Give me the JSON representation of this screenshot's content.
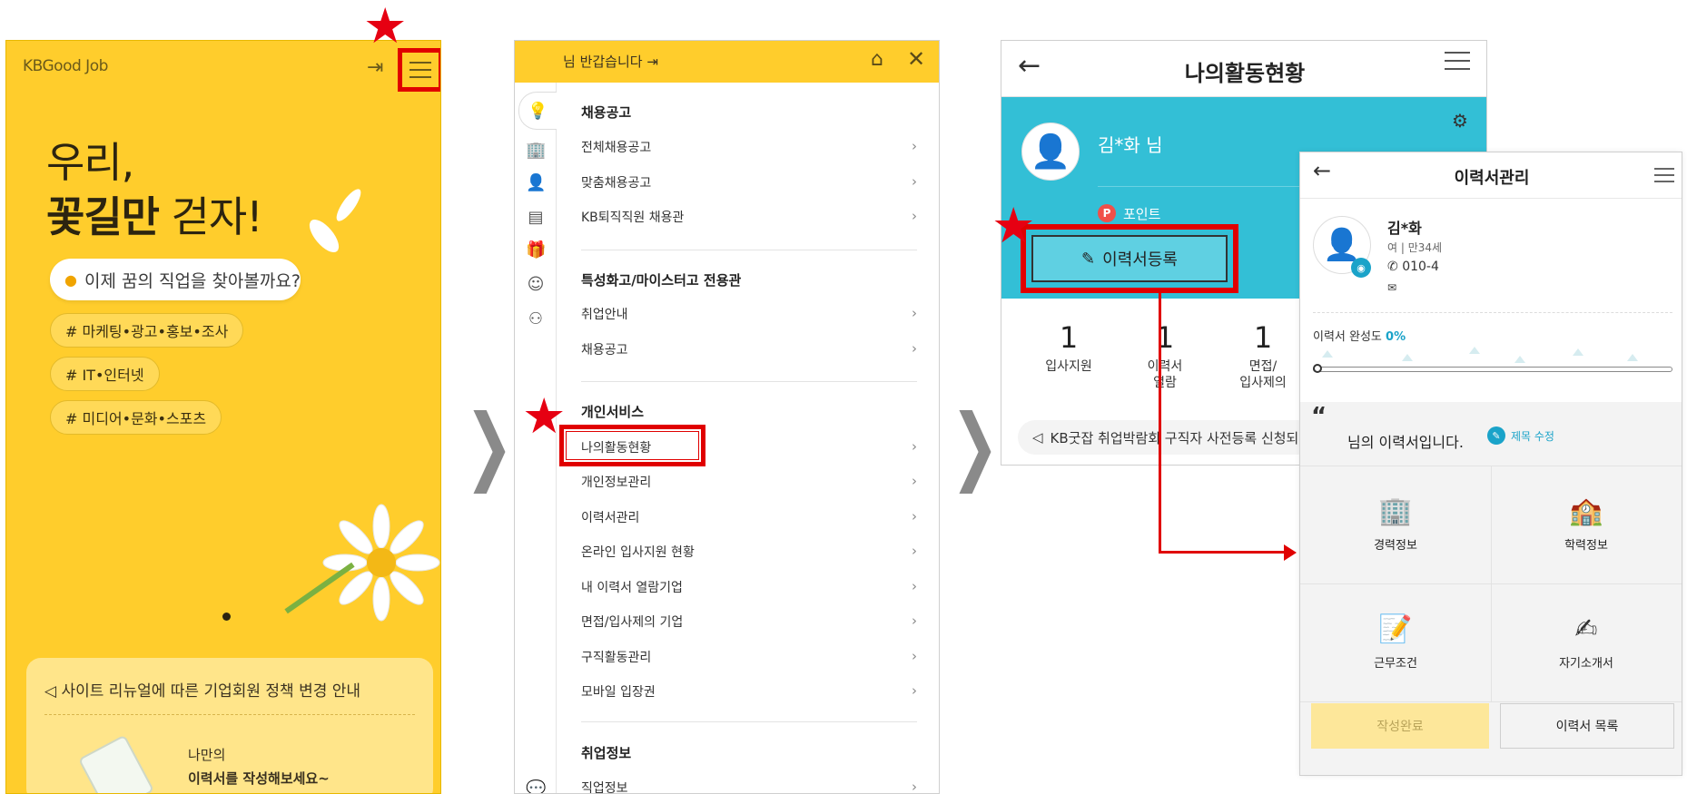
{
  "panel1": {
    "logo": "KBGood Job",
    "headline_line1": "우리,",
    "headline_line2_bold": "꽃길만",
    "headline_line2_rest": " 걷자!",
    "search_placeholder": "이제 꿈의 직업을 찾아볼까요?",
    "tags": [
      "# 마케팅•광고•홍보•조사",
      "# IT•인터넷",
      "# 미디어•문화•스포츠"
    ],
    "notice_title": "사이트 리뉴얼에 따른 기업회원 정책 변경 안내",
    "notice_text1": "나만의",
    "notice_text2": "이력서를 작성해보세요~"
  },
  "panel2": {
    "greeting": "님 반갑습니다",
    "sections": [
      {
        "title": "채용공고",
        "items": [
          "전체채용공고",
          "맞춤채용공고",
          "KB퇴직직원 채용관"
        ]
      },
      {
        "title": "특성화고/마이스터고 전용관",
        "items": [
          "취업안내",
          "채용공고"
        ]
      },
      {
        "title": "개인서비스",
        "items": [
          "나의활동현황",
          "개인정보관리",
          "이력서관리",
          "온라인 입사지원 현황",
          "내 이력서 열람기업",
          "면접/입사제의 기업",
          "구직활동관리",
          "모바일 입장권"
        ]
      },
      {
        "title": "취업정보",
        "items": [
          "직업정보"
        ]
      }
    ]
  },
  "panel3": {
    "title": "나의활동현황",
    "user_name": "김*화 님",
    "points_label": "포인트",
    "register_button": "이력서등록",
    "stats": [
      {
        "num": "1",
        "label": "입사지원"
      },
      {
        "num": "1",
        "label": "이력서\n열람"
      },
      {
        "num": "1",
        "label": "면접/\n입사제의"
      }
    ],
    "ticker": "KB굿잡 취업박람회 구직자 사전등록 신청되었"
  },
  "panel4": {
    "title": "이력서관리",
    "name": "김*화",
    "info": "여 | 만34세",
    "phone": "010-4",
    "completion_label": "이력서 완성도",
    "completion_value": "0%",
    "resume_title": "님의 이력서입니다.",
    "edit_title": "제목 수정",
    "cells": [
      "경력정보",
      "학력정보",
      "근무조건",
      "자기소개서"
    ],
    "btn_done": "작성완료",
    "btn_list": "이력서 목록"
  }
}
